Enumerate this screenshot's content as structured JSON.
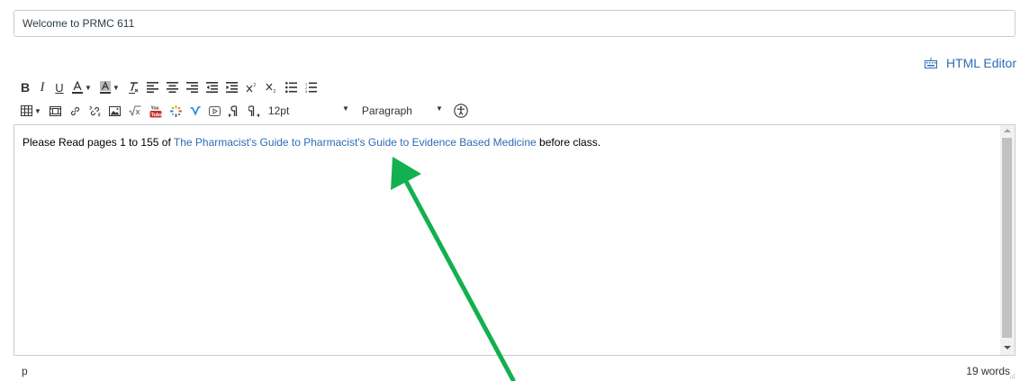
{
  "title_field": {
    "value": "Welcome to PRMC 611"
  },
  "html_editor": {
    "label": "HTML Editor",
    "icon": "keyboard-icon"
  },
  "toolbar": {
    "bold": "B",
    "italic": "I",
    "underline": "U",
    "font_size": "12pt",
    "block_format": "Paragraph"
  },
  "content": {
    "prefix": "Please Read pages 1 to 155 of ",
    "link_text": "The Pharmacist's Guide to Pharmacist's Guide to Evidence Based Medicine",
    "suffix": " before class."
  },
  "status": {
    "path": "p",
    "word_count": "19 words"
  },
  "annotation": {
    "arrow_color": "#12b04f"
  }
}
